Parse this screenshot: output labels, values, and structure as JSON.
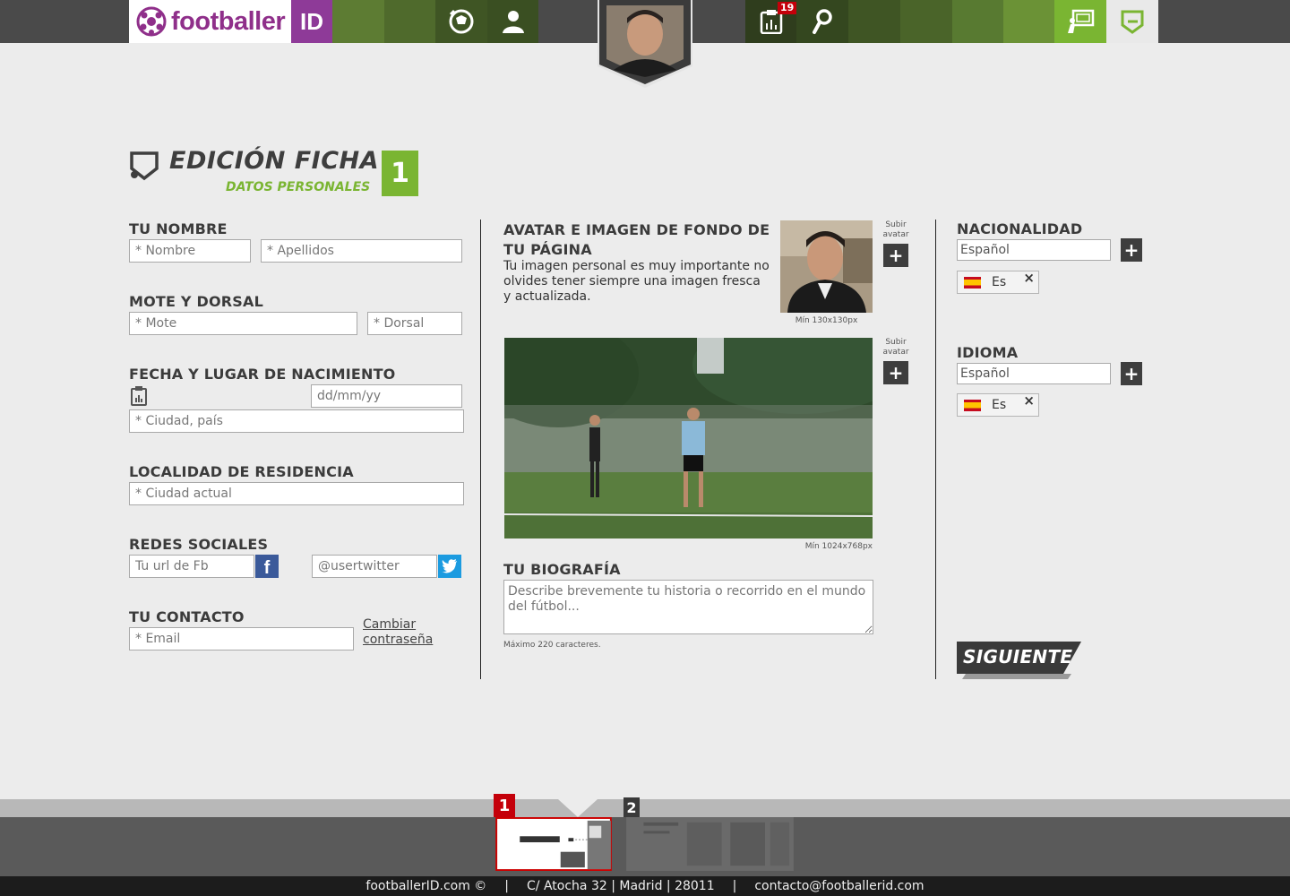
{
  "header": {
    "brand_text": "footballer",
    "brand_id": "ID",
    "notification_count": "19",
    "colors": {
      "brand": "#8e3a98",
      "accent": "#7ab532",
      "bar": "#4a4a4a"
    }
  },
  "page": {
    "title": "EDICIÓN FICHA",
    "subtitle": "DATOS PERSONALES",
    "step": "1"
  },
  "left": {
    "name_label": "TU NOMBRE",
    "first_name_ph": "* Nombre",
    "last_name_ph": "* Apellidos",
    "nick_label": "MOTE Y DORSAL",
    "nick_ph": "* Mote",
    "number_ph": "* Dorsal",
    "birth_label": "FECHA Y LUGAR DE NACIMIENTO",
    "date_ph": "dd/mm/yy",
    "birthplace_ph": "* Ciudad, país",
    "residence_label": "LOCALIDAD DE RESIDENCIA",
    "residence_ph": "* Ciudad actual",
    "social_label": "REDES SOCIALES",
    "fb_ph": "Tu url de Fb",
    "twitter_ph": "@usertwitter",
    "contact_label": "TU CONTACTO",
    "email_ph": "* Email",
    "change_password_line1": "Cambiar",
    "change_password_line2": "contraseña"
  },
  "middle": {
    "avatar_label_line1": "AVATAR E IMAGEN DE FONDO DE",
    "avatar_label_line2": "TU PÁGINA",
    "avatar_desc_line1": "Tu imagen personal es muy importante no",
    "avatar_desc_line2": "olvides tener siempre una imagen fresca",
    "avatar_desc_line3": "y actualizada.",
    "upload_label_line1": "Subir",
    "upload_label_line2": "avatar",
    "avatar_min": "Mín 130x130px",
    "background_min": "Mín 1024x768px",
    "bio_label": "TU BIOGRAFÍA",
    "bio_ph": "Describe brevemente tu historia o recorrido en el mundo del fútbol...",
    "bio_max": "Máximo 220 caracteres."
  },
  "right": {
    "nationality_label": "NACIONALIDAD",
    "nationality_value": "Español",
    "nationality_chip": "Es",
    "language_label": "IDIOMA",
    "language_value": "Español",
    "language_chip": "Es",
    "next_button": "SIGUIENTE"
  },
  "footer": {
    "step1": "1",
    "step2": "2",
    "site": "footballerID.com ©",
    "address": "C/ Atocha 32 | Madrid | 28011",
    "email": "contacto@footballerid.com",
    "separator": "|"
  }
}
